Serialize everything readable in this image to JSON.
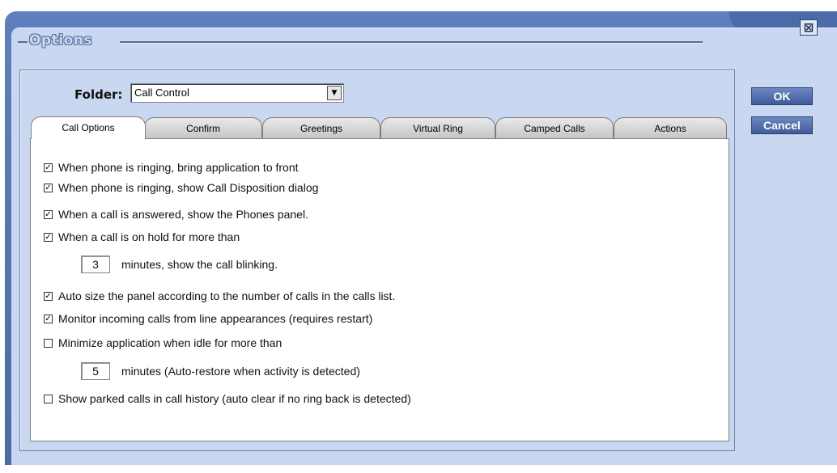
{
  "window": {
    "title": "Options",
    "close_glyph": "⊠"
  },
  "folder": {
    "label": "Folder:",
    "value": "Call Control"
  },
  "tabs": [
    {
      "label": "Call Options"
    },
    {
      "label": "Confirm"
    },
    {
      "label": "Greetings"
    },
    {
      "label": "Virtual Ring"
    },
    {
      "label": "Camped Calls"
    },
    {
      "label": "Actions"
    }
  ],
  "options": {
    "ring_bring_front": {
      "label": "When phone is ringing, bring application to front",
      "checked": true
    },
    "ring_show_disposition": {
      "label": "When phone is ringing, show Call Disposition dialog",
      "checked": true
    },
    "answered_show_phones": {
      "label": "When a call is answered, show the Phones panel.",
      "checked": true
    },
    "hold_more_than": {
      "label": "When a call is on hold for more than",
      "checked": true
    },
    "hold_minutes": {
      "value": "3",
      "label": "minutes, show the call blinking."
    },
    "auto_size": {
      "label": "Auto size the panel according to the number of calls in the calls list.",
      "checked": true
    },
    "monitor_incoming": {
      "label": "Monitor incoming calls from line appearances (requires restart)",
      "checked": true
    },
    "minimize_idle": {
      "label": "Minimize application when idle for more than",
      "checked": false
    },
    "idle_minutes": {
      "value": "5",
      "label": "minutes (Auto-restore when activity is detected)"
    },
    "show_parked": {
      "label": "Show parked calls in call history (auto clear if no ring back is detected)",
      "checked": false
    }
  },
  "buttons": {
    "ok": "OK",
    "cancel": "Cancel"
  },
  "colors": {
    "frame": "#4b6aaa",
    "panel": "#c9d8f0",
    "button": "#3e5c9c"
  }
}
